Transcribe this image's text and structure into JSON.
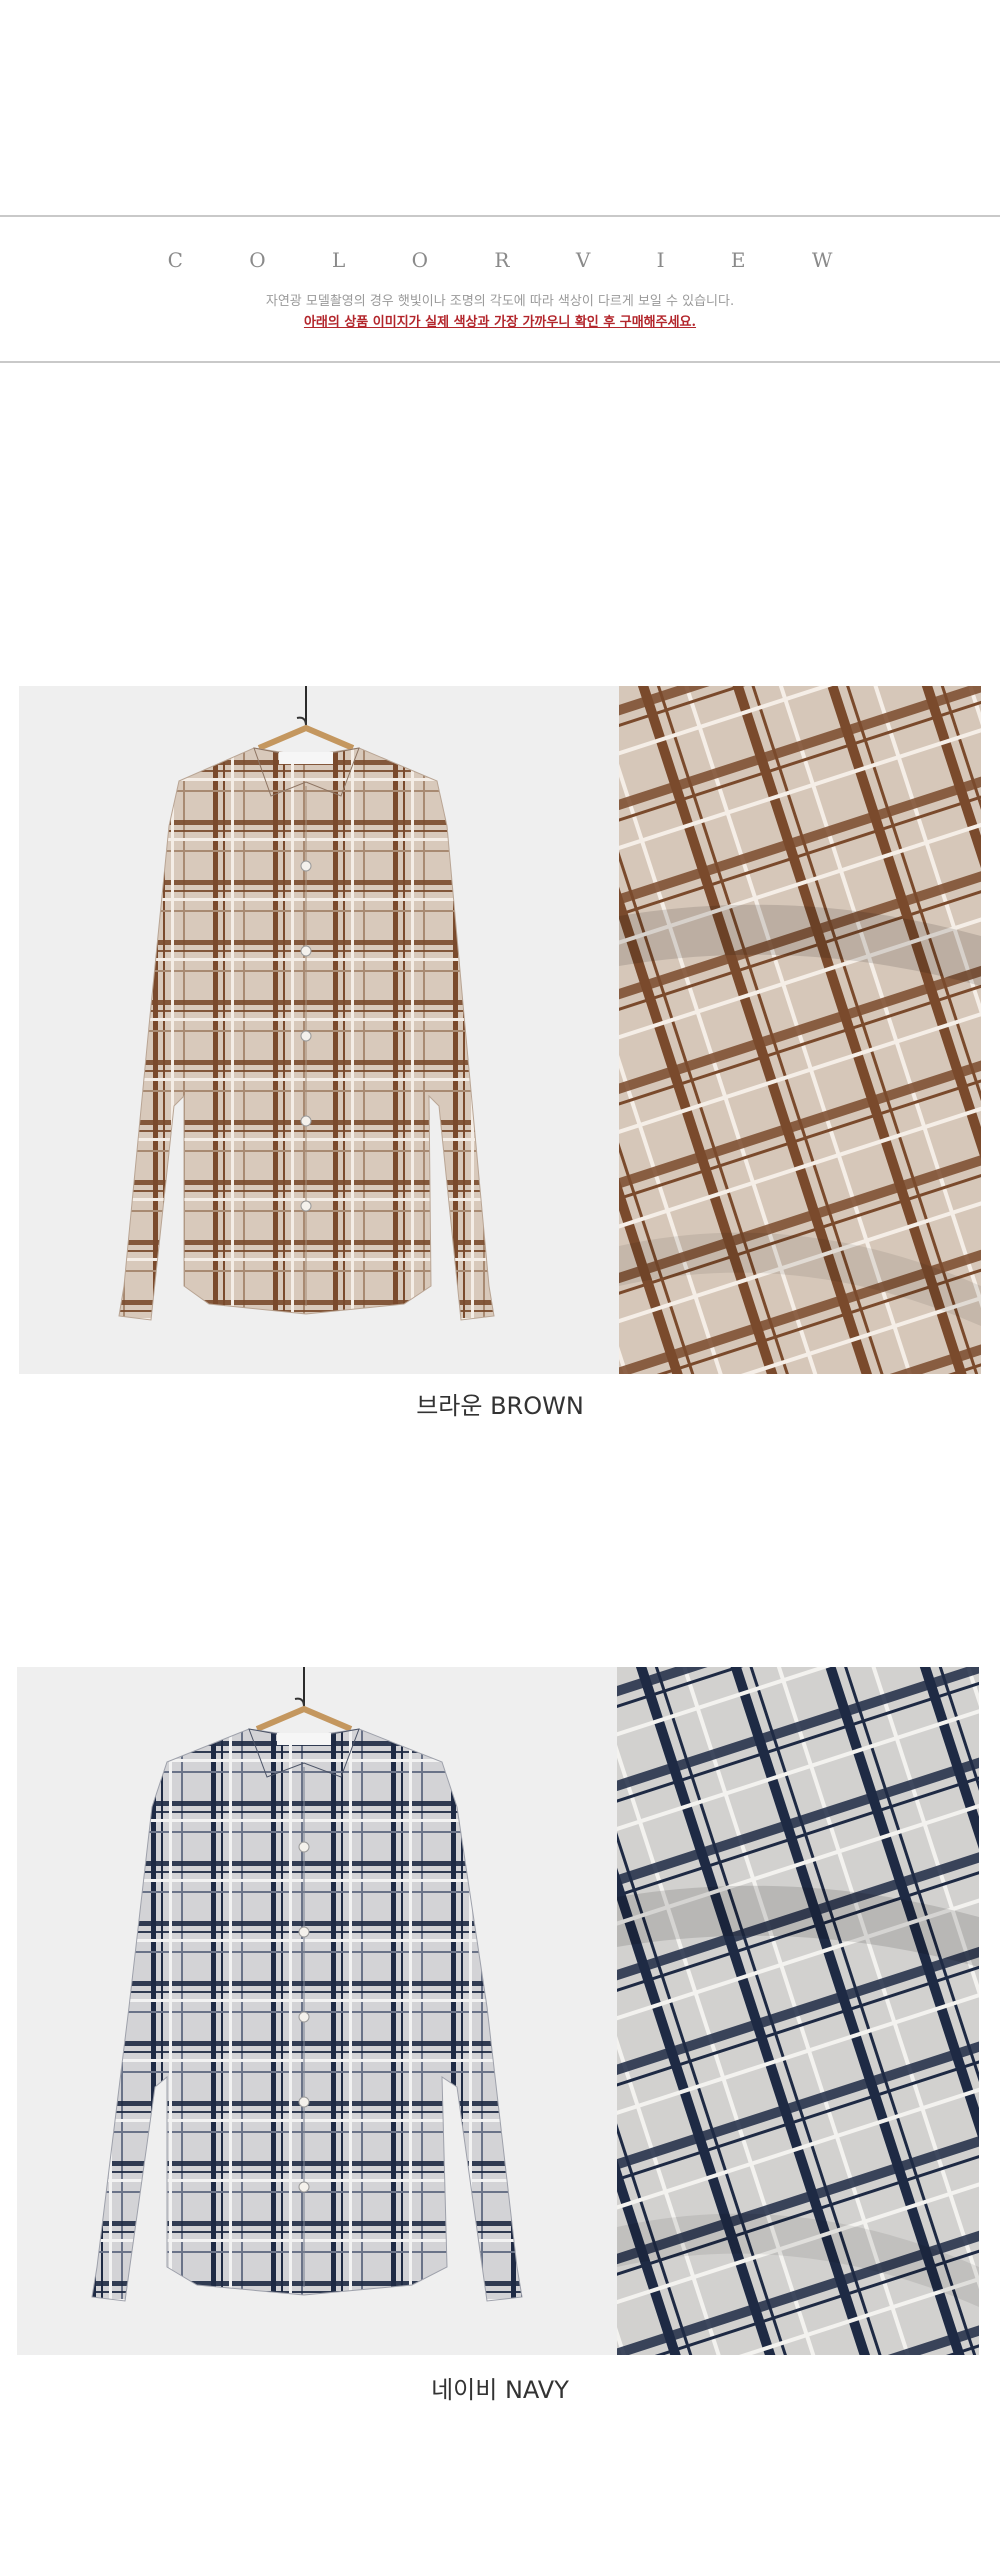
{
  "header": {
    "title": "C O L O R   V I E W",
    "note": "자연광 모델촬영의 경우 햇빛이나 조명의 각도에 따라 색상이 다르게 보일 수 있습니다.",
    "warning": "아래의 상품 이미지가 실제 색상과 가장 가까우니 확인 후 구매해주세요."
  },
  "colors": [
    {
      "caption": "브라운 BROWN",
      "main_color": "#7a4a2c",
      "base_color": "#d8c9bb"
    },
    {
      "caption": "네이비 NAVY",
      "main_color": "#1e2a44",
      "base_color": "#d3d3d6"
    }
  ]
}
